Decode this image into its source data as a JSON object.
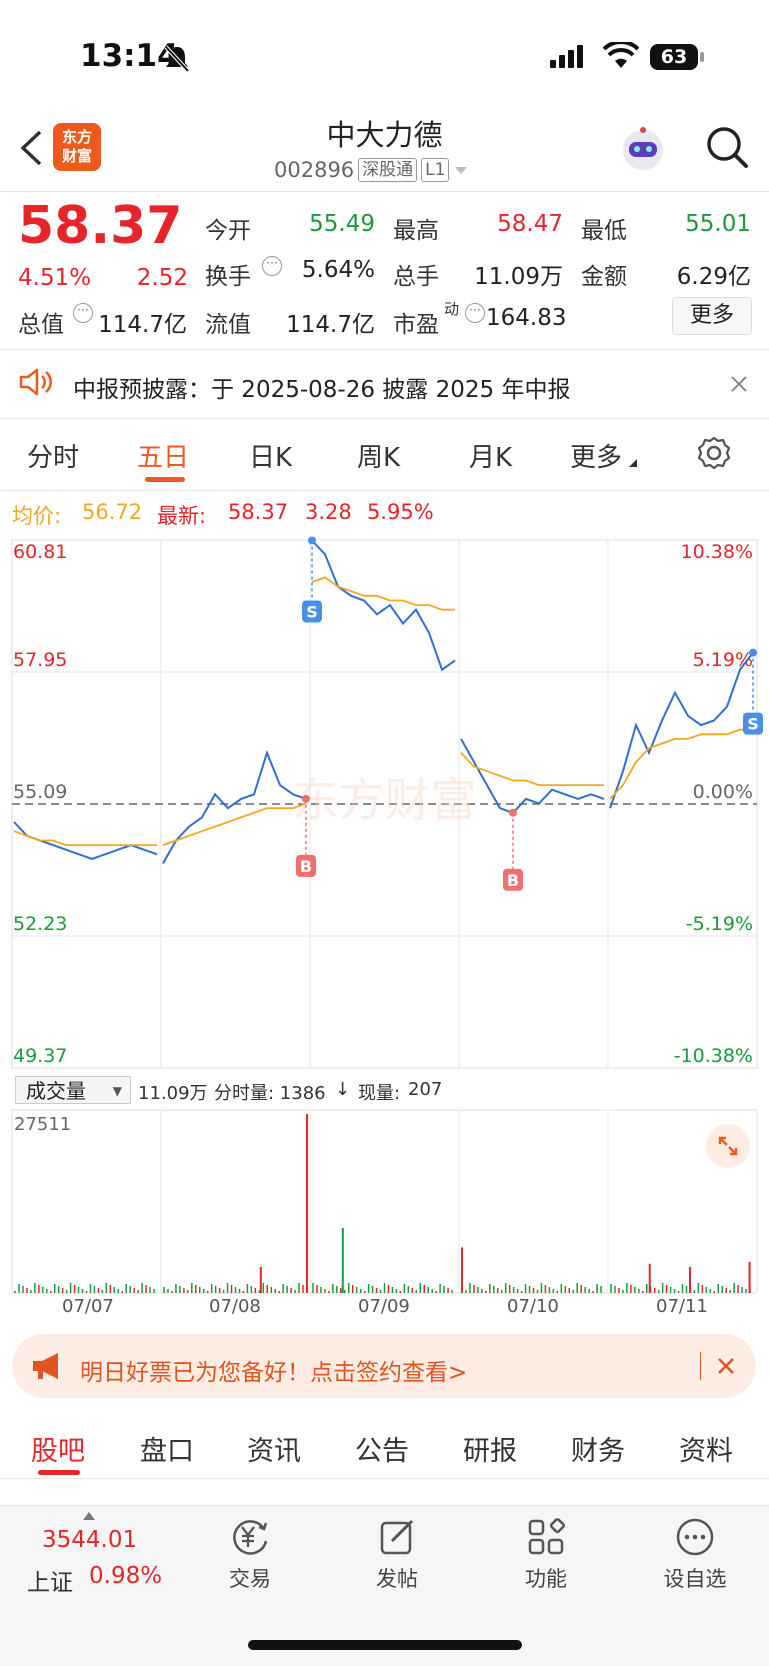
{
  "status_bar": {
    "time": "13:14",
    "battery": "63"
  },
  "header": {
    "logo_line1": "东方",
    "logo_line2": "财富",
    "stock_name": "中大力德",
    "stock_code": "002896",
    "tag_connect": "深股通",
    "tag_level": "L1"
  },
  "quote": {
    "price": "58.37",
    "change_pct": "4.51%",
    "change": "2.52",
    "open_label": "今开",
    "open": "55.49",
    "high_label": "最高",
    "high": "58.47",
    "low_label": "最低",
    "low": "55.01",
    "turnover_label": "换手",
    "turnover": "5.64%",
    "volume_label": "总手",
    "volume": "11.09万",
    "amount_label": "金额",
    "amount": "6.29亿",
    "mcap_label": "总值",
    "mcap": "114.7亿",
    "float_label": "流值",
    "float_mcap": "114.7亿",
    "pe_label": "市盈",
    "pe_sup": "动",
    "pe": "164.83",
    "more_button": "更多"
  },
  "notice": {
    "text": "中报预披露：于 2025-08-26 披露 2025 年中报"
  },
  "chart_tabs": [
    "分时",
    "五日",
    "日K",
    "周K",
    "月K",
    "更多"
  ],
  "chart_info": {
    "avg_label": "均价:",
    "avg_value": "56.72",
    "last_label": "最新:",
    "last_value": "58.37",
    "change": "3.28",
    "change_pct": "5.95%"
  },
  "volume_header": {
    "select_label": "成交量",
    "total": "11.09万",
    "minute_vol": "分时量: 1386",
    "arrow": "↓",
    "current_label": "现量:",
    "current_value": "207",
    "vol_max": "27511"
  },
  "watermark": "东方财富",
  "chart_data": {
    "type": "line",
    "title": "",
    "y_left_ticks": [
      "60.81",
      "57.95",
      "55.09",
      "52.23",
      "49.37"
    ],
    "y_right_ticks": [
      "10.38%",
      "5.19%",
      "0.00%",
      "-5.19%",
      "-10.38%"
    ],
    "ylim": [
      49.37,
      60.81
    ],
    "prev_close": 55.09,
    "x_ticks": [
      "07/07",
      "07/08",
      "07/09",
      "07/10",
      "07/11"
    ],
    "series": [
      {
        "name": "",
        "color": "#2e6fd1",
        "days": [
          [
            54.7,
            54.4,
            54.3,
            54.2,
            54.1,
            54.0,
            53.9,
            54.0,
            54.1,
            54.2,
            54.1,
            54.0
          ],
          [
            53.8,
            54.3,
            54.6,
            54.8,
            55.3,
            55.0,
            55.2,
            55.3,
            56.2,
            55.5,
            55.3,
            55.2
          ],
          [
            60.8,
            60.5,
            59.8,
            59.6,
            59.5,
            59.2,
            59.4,
            59.0,
            59.3,
            58.8,
            58.0,
            58.2
          ],
          [
            56.5,
            56.0,
            55.5,
            55.0,
            54.9,
            55.2,
            55.1,
            55.4,
            55.3,
            55.2,
            55.3,
            55.2
          ],
          [
            55.0,
            55.8,
            56.8,
            56.2,
            56.9,
            57.5,
            57.0,
            56.8,
            56.9,
            57.2,
            58.0,
            58.37
          ]
        ]
      },
      {
        "name": "",
        "color": "#f4a623",
        "days": [
          [
            54.5,
            54.4,
            54.3,
            54.3,
            54.2,
            54.2,
            54.2,
            54.2,
            54.2,
            54.2,
            54.2,
            54.2
          ],
          [
            54.2,
            54.3,
            54.4,
            54.5,
            54.6,
            54.7,
            54.8,
            54.9,
            55.0,
            55.0,
            55.0,
            55.1
          ],
          [
            59.9,
            60.0,
            59.8,
            59.7,
            59.6,
            59.6,
            59.5,
            59.5,
            59.4,
            59.4,
            59.3,
            59.3
          ],
          [
            56.2,
            55.9,
            55.8,
            55.7,
            55.6,
            55.6,
            55.5,
            55.5,
            55.5,
            55.5,
            55.5,
            55.5
          ],
          [
            55.2,
            55.5,
            56.0,
            56.3,
            56.4,
            56.5,
            56.5,
            56.6,
            56.6,
            56.6,
            56.7,
            56.72
          ]
        ]
      }
    ],
    "trade_markers": [
      {
        "label": "S",
        "day": 2,
        "point": 0,
        "color": "#4a8fe7"
      },
      {
        "label": "B",
        "day": 1,
        "point": 11,
        "color": "#f07070"
      },
      {
        "label": "B",
        "day": 3,
        "point": 4,
        "color": "#f07070"
      },
      {
        "label": "S",
        "day": 4,
        "point": 11,
        "color": "#4a8fe7"
      }
    ],
    "volume": {
      "ymax": 27511,
      "spikes": [
        {
          "day": 1,
          "pos": 0.67,
          "value": 4000,
          "color": "#e5252a"
        },
        {
          "day": 1,
          "pos": 0.98,
          "value": 27511,
          "color": "#e5252a"
        },
        {
          "day": 2,
          "pos": 0.22,
          "value": 10000,
          "color": "#1a9a3a"
        },
        {
          "day": 3,
          "pos": 0.02,
          "value": 7000,
          "color": "#e5252a"
        },
        {
          "day": 4,
          "pos": 0.28,
          "value": 4500,
          "color": "#e5252a"
        },
        {
          "day": 4,
          "pos": 0.55,
          "value": 4000,
          "color": "#e5252a"
        },
        {
          "day": 4,
          "pos": 0.95,
          "value": 4800,
          "color": "#e5252a"
        }
      ]
    }
  },
  "promo": {
    "text": "明日好票已为您备好！点击签约查看>"
  },
  "sub_tabs": [
    "股吧",
    "盘口",
    "资讯",
    "公告",
    "研报",
    "财务",
    "资料"
  ],
  "bottom_bar": {
    "index_value": "3544.01",
    "index_name": "上证",
    "index_change": "0.98%",
    "items": [
      "交易",
      "发帖",
      "功能",
      "设自选"
    ]
  }
}
